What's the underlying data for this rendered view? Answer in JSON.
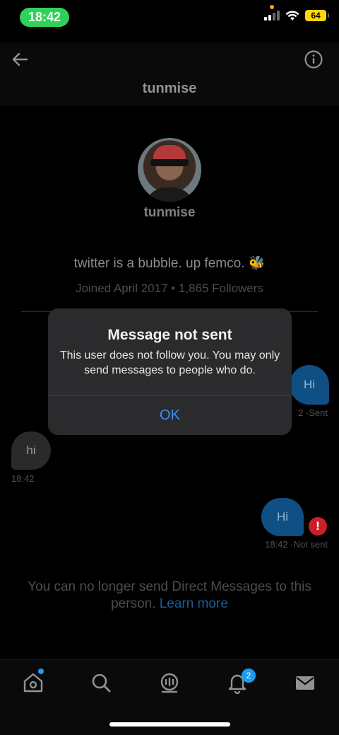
{
  "status_bar": {
    "time": "18:42",
    "battery": "64"
  },
  "header": {
    "title": "tunmise"
  },
  "profile": {
    "name": "tunmise",
    "bio": "twitter is a bubble. up femco. 🐝",
    "joined": "Joined April 2017 • 1,865 Followers"
  },
  "messages": [
    {
      "text": "Hi",
      "meta": "2 ·Sent",
      "direction": "out"
    },
    {
      "text": "hi",
      "meta": "18:42",
      "direction": "in"
    },
    {
      "text": "Hi",
      "meta": "18:42 ·Not sent",
      "direction": "out",
      "error_icon": "!"
    }
  ],
  "notice": {
    "text": "You can no longer send Direct Messages to this person.",
    "link": "Learn more"
  },
  "alert": {
    "title": "Message not sent",
    "message": "This user does not follow you. You may only send messages to people who do.",
    "ok_label": "OK"
  },
  "tab_bar": {
    "items": [
      "home-icon",
      "search-icon",
      "spaces-icon",
      "notifications-icon",
      "messages-icon"
    ],
    "notification_count": "2"
  },
  "colors": {
    "accent": "#1d9bf0",
    "alert_button": "#3d8ef5",
    "error": "#c8202a",
    "time_pill": "#30d158"
  }
}
